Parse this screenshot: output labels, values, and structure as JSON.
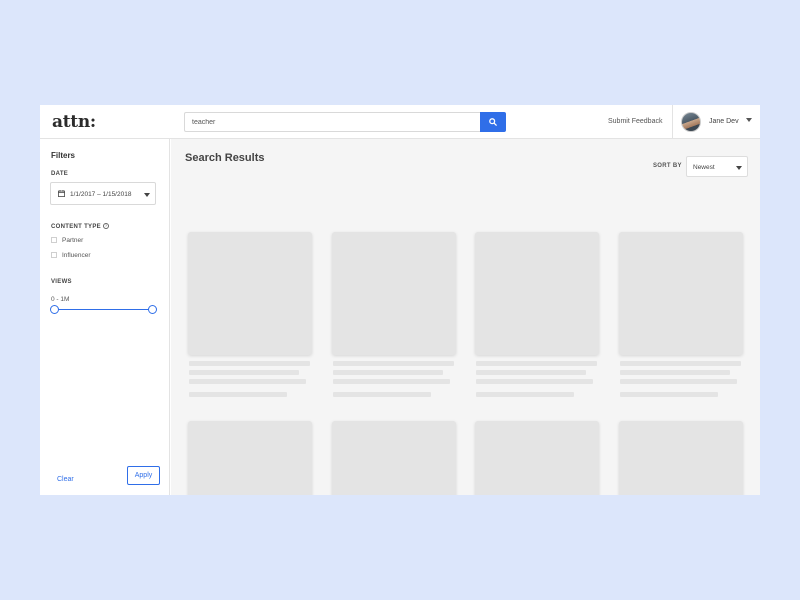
{
  "header": {
    "logo": "attn:",
    "search": {
      "value": "teacher",
      "placeholder": ""
    },
    "feedback_label": "Submit Feedback",
    "user": {
      "name": "Jane Dev"
    }
  },
  "sidebar": {
    "title": "Filters",
    "date": {
      "label": "DATE",
      "value": "1/1/2017 – 1/15/2018"
    },
    "content_type": {
      "label": "CONTENT TYPE",
      "options": [
        {
          "label": "Partner",
          "checked": false
        },
        {
          "label": "Influencer",
          "checked": false
        }
      ]
    },
    "views": {
      "label": "VIEWS",
      "range_text": "0 - 1M",
      "slider_min": 0,
      "slider_max": 1
    },
    "clear_label": "Clear",
    "apply_label": "Apply"
  },
  "main": {
    "title": "Search Results",
    "sort": {
      "label": "SORT BY",
      "value": "Newest"
    },
    "results": [
      {
        "state": "loading"
      },
      {
        "state": "loading"
      },
      {
        "state": "loading"
      },
      {
        "state": "loading"
      },
      {
        "state": "loading"
      },
      {
        "state": "loading"
      },
      {
        "state": "loading"
      },
      {
        "state": "loading"
      }
    ]
  },
  "colors": {
    "page_background": "#dce6fb",
    "accent": "#2f6ee8",
    "placeholder": "#e4e4e4",
    "main_background": "#f5f5f5"
  },
  "icons": [
    "search-icon",
    "calendar-icon",
    "help-icon",
    "chevron-down-icon"
  ]
}
